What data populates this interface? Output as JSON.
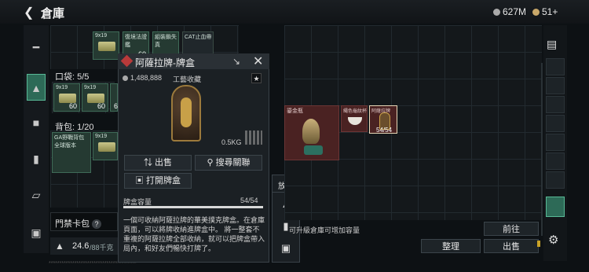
{
  "header": {
    "back_icon": "back-arrow-icon",
    "title": "倉庫",
    "currency1": "627M",
    "currency2": "51+"
  },
  "left_grid": {
    "top_items": [
      {
        "name": "9x19",
        "count": ""
      },
      {
        "name": "復境法證鑑",
        "count": "60"
      },
      {
        "name": "組裝鎖失真",
        "count": ""
      },
      {
        "name": "CAT止血帶",
        "count": ""
      }
    ],
    "pocket_label": "口袋:",
    "pocket_value": "5/5",
    "pocket_items": [
      {
        "name": "9x19",
        "count": "60"
      },
      {
        "name": "9x19",
        "count": "60"
      },
      {
        "name": "9x19",
        "count": "60"
      }
    ],
    "backpack_label": "背包:",
    "backpack_value": "1/20",
    "backpack_items": [
      {
        "name": "GA野戰背包 全球版本",
        "count": ""
      },
      {
        "name": "9x19",
        "count": ""
      }
    ],
    "card_label": "門禁卡包",
    "weight_value": "24.6",
    "weight_max": "/88千克",
    "bottom_text": "*****************************************"
  },
  "popup": {
    "title": "阿薩拉牌-牌盒",
    "price": "1,488,888",
    "category": "工藝收藏",
    "weight": "0.5KG",
    "sell_label": "出售",
    "search_label": "搜尋關聯",
    "open_label": "打開牌盒",
    "capacity_label": "牌盒容量",
    "capacity_value": "54/54",
    "capacity_fraction": 1.0,
    "description": "一個可收納阿薩拉牌的華美撲克牌盒。在倉庫頁面，可以將牌收納進牌盒中。 將一整套不重複的阿薩拉牌全部收納，就可以把牌盒帶入局內，和好友們暢快打牌了。"
  },
  "side_menu": {
    "label": "放入"
  },
  "right_grid": {
    "items": [
      {
        "name": "鎏金瓶",
        "count": ""
      },
      {
        "name": "縄色龜紋杯",
        "count": ""
      },
      {
        "name": "阿薩拉牌",
        "count": "54/54"
      }
    ],
    "upgrade_hint": "可升級倉庫可增加容量",
    "goto_label": "前往",
    "sort_label": "整理",
    "sell_label": "出售"
  },
  "colors": {
    "accent_green": "#2d6a57",
    "red_item": "#4a2222",
    "yellow_badge": "#c9a227"
  }
}
